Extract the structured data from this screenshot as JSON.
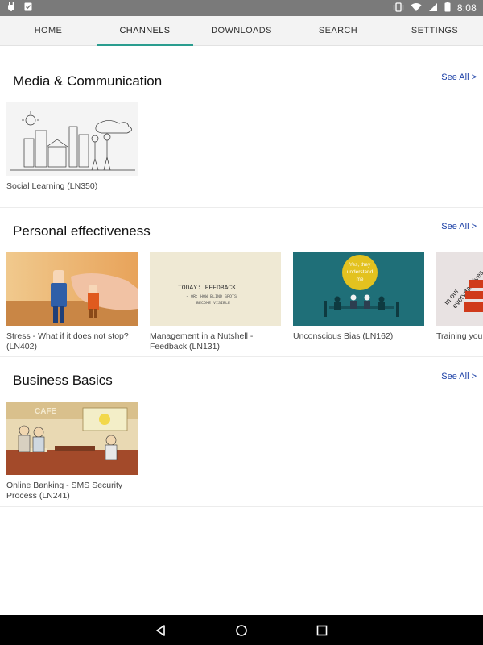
{
  "status_bar": {
    "time": "8:08",
    "left_icons": [
      "android-debug-icon",
      "clipboard-check-icon"
    ],
    "right_icons": [
      "vibrate-icon",
      "wifi-icon",
      "signal-icon",
      "battery-icon"
    ]
  },
  "tabs": [
    {
      "label": "HOME",
      "active": false
    },
    {
      "label": "CHANNELS",
      "active": true
    },
    {
      "label": "DOWNLOADS",
      "active": false
    },
    {
      "label": "SEARCH",
      "active": false
    },
    {
      "label": "SETTINGS",
      "active": false
    }
  ],
  "sections": [
    {
      "title": "Media & Communication",
      "see_all": "See All >",
      "cards": [
        {
          "title": "Social Learning (LN350)"
        }
      ]
    },
    {
      "title": "Personal effectiveness",
      "see_all": "See All >",
      "cards": [
        {
          "title": "Stress - What if it does not stop? (LN402)"
        },
        {
          "title": "Management in a Nutshell - Feedback (LN131)",
          "thumb_text": [
            "TODAY: FEEDBACK",
            "- OR: HOW BLIND SPOTS",
            "BECOME VISIBLE"
          ]
        },
        {
          "title": "Unconscious Bias (LN162)",
          "thumb_text": [
            "Yes, they",
            "understand",
            "me"
          ]
        },
        {
          "title": "Training you",
          "thumb_text": [
            "In our",
            "everyday lives,"
          ]
        }
      ]
    },
    {
      "title": "Business Basics",
      "see_all": "See All >",
      "cards": [
        {
          "title": "Online Banking - SMS Security Process (LN241)",
          "thumb_text": [
            "CAFE"
          ]
        }
      ]
    }
  ],
  "nav": {
    "buttons": [
      "back-icon",
      "home-icon",
      "recents-icon"
    ]
  }
}
